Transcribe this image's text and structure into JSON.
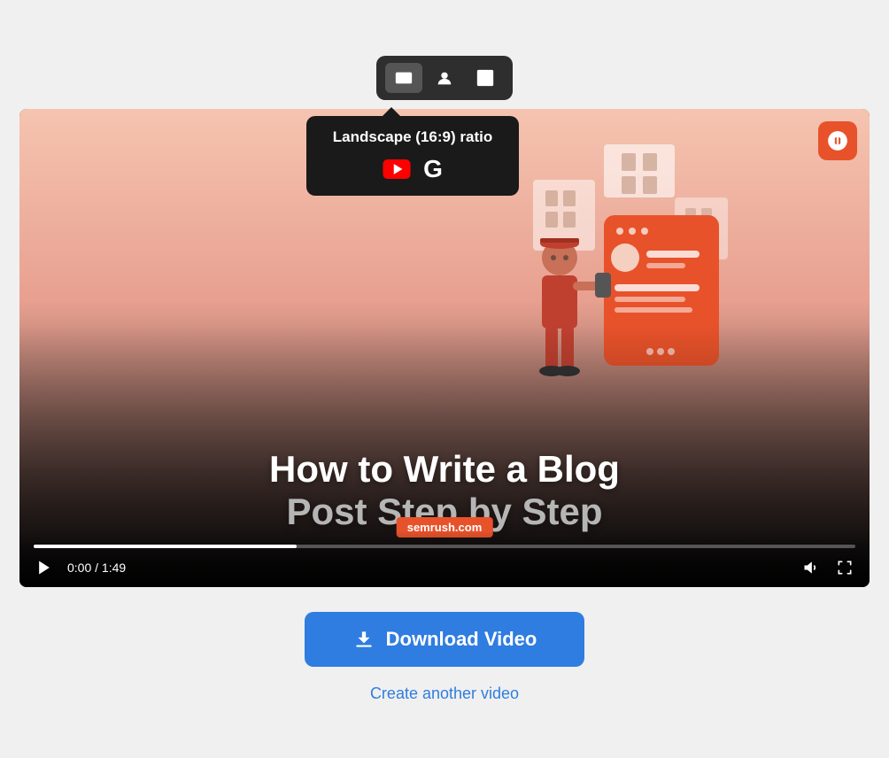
{
  "toolbar": {
    "buttons": [
      {
        "id": "landscape",
        "label": "Landscape",
        "active": true
      },
      {
        "id": "portrait",
        "label": "Portrait",
        "active": false
      },
      {
        "id": "square",
        "label": "Square",
        "active": false
      }
    ]
  },
  "tooltip": {
    "title": "Landscape (16:9) ratio",
    "platforms": [
      "YouTube",
      "Google"
    ]
  },
  "video": {
    "title_line1": "How to Write a Blog",
    "title_line2": "Post Step by Step",
    "time_current": "0:00",
    "time_total": "1:49",
    "time_display": "0:00 / 1:49",
    "progress_percent": 32,
    "watermark": "semrush.com"
  },
  "semrush_logo": {
    "alt": "Semrush"
  },
  "download_button": {
    "label": "Download Video"
  },
  "create_another": {
    "label": "Create another video"
  }
}
